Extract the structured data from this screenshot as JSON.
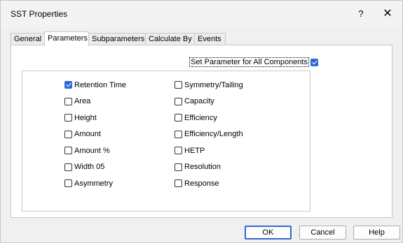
{
  "window": {
    "title": "SST Properties",
    "help_glyph": "?",
    "close_glyph": "✕"
  },
  "tabs": [
    {
      "label": "General",
      "active": false
    },
    {
      "label": "Parameters",
      "active": true
    },
    {
      "label": "Subparameters",
      "active": false
    },
    {
      "label": "Calculate By",
      "active": false
    },
    {
      "label": "Events",
      "active": false
    }
  ],
  "set_all": {
    "label": "Set Parameter for All Components",
    "checked": true
  },
  "left_options": [
    {
      "label": "Retention Time",
      "checked": true
    },
    {
      "label": "Area",
      "checked": false
    },
    {
      "label": "Height",
      "checked": false
    },
    {
      "label": "Amount",
      "checked": false
    },
    {
      "label": "Amount %",
      "checked": false
    },
    {
      "label": "Width 05",
      "checked": false
    },
    {
      "label": "Asymmetry",
      "checked": false
    }
  ],
  "right_options": [
    {
      "label": "Symmetry/Tailing",
      "checked": false
    },
    {
      "label": "Capacity",
      "checked": false
    },
    {
      "label": "Efficiency",
      "checked": false
    },
    {
      "label": "Efficiency/Length",
      "checked": false
    },
    {
      "label": "HETP",
      "checked": false
    },
    {
      "label": "Resolution",
      "checked": false
    },
    {
      "label": "Response",
      "checked": false
    }
  ],
  "buttons": {
    "ok": "OK",
    "cancel": "Cancel",
    "help": "Help"
  },
  "colors": {
    "accent": "#2f6ad4"
  }
}
